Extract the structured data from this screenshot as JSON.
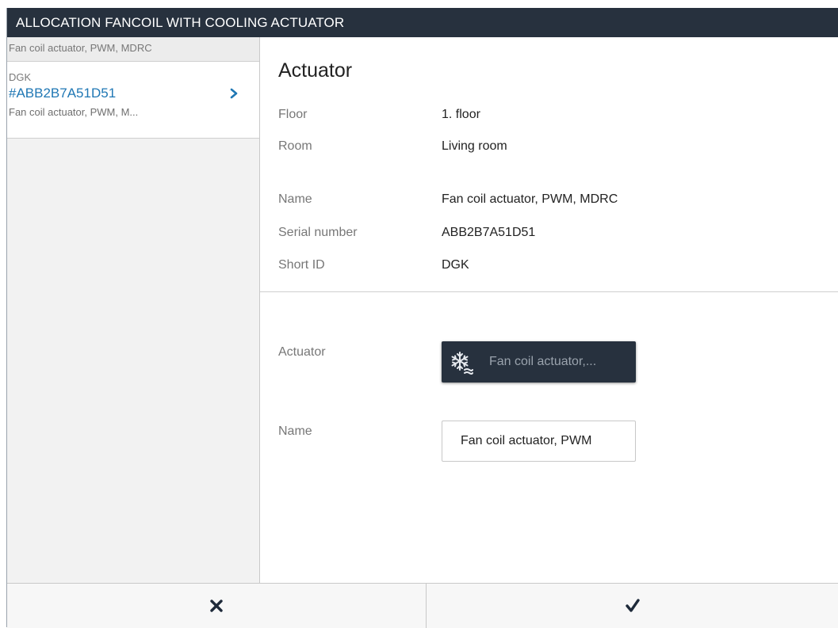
{
  "window": {
    "title": "ALLOCATION FANCOIL WITH COOLING ACTUATOR"
  },
  "sidebar": {
    "group_header": "Fan coil actuator, PWM, MDRC",
    "items": [
      {
        "short_id": "DGK",
        "serial": "#ABB2B7A51D51",
        "subtitle": "Fan coil actuator, PWM, M...",
        "icon": "chevron-right-icon"
      }
    ]
  },
  "main": {
    "title": "Actuator",
    "info": {
      "floor_label": "Floor",
      "floor_value": "1. floor",
      "room_label": "Room",
      "room_value": "Living room",
      "name_label": "Name",
      "name_value": "Fan coil actuator, PWM, MDRC",
      "serial_label": "Serial number",
      "serial_value": "ABB2B7A51D51",
      "short_id_label": "Short ID",
      "short_id_value": "DGK"
    },
    "form": {
      "actuator_label": "Actuator",
      "actuator_button_text": "Fan coil actuator,...",
      "actuator_icon": "snowflake-icon",
      "name_label": "Name",
      "name_input_value": "Fan coil actuator, PWM"
    }
  },
  "footer": {
    "cancel_icon": "close-icon",
    "confirm_icon": "check-icon"
  },
  "colors": {
    "titlebar_bg": "#27313e",
    "link_blue": "#1f77b4",
    "button_dark": "#27313e",
    "icon_dark": "#1e2a3a"
  }
}
